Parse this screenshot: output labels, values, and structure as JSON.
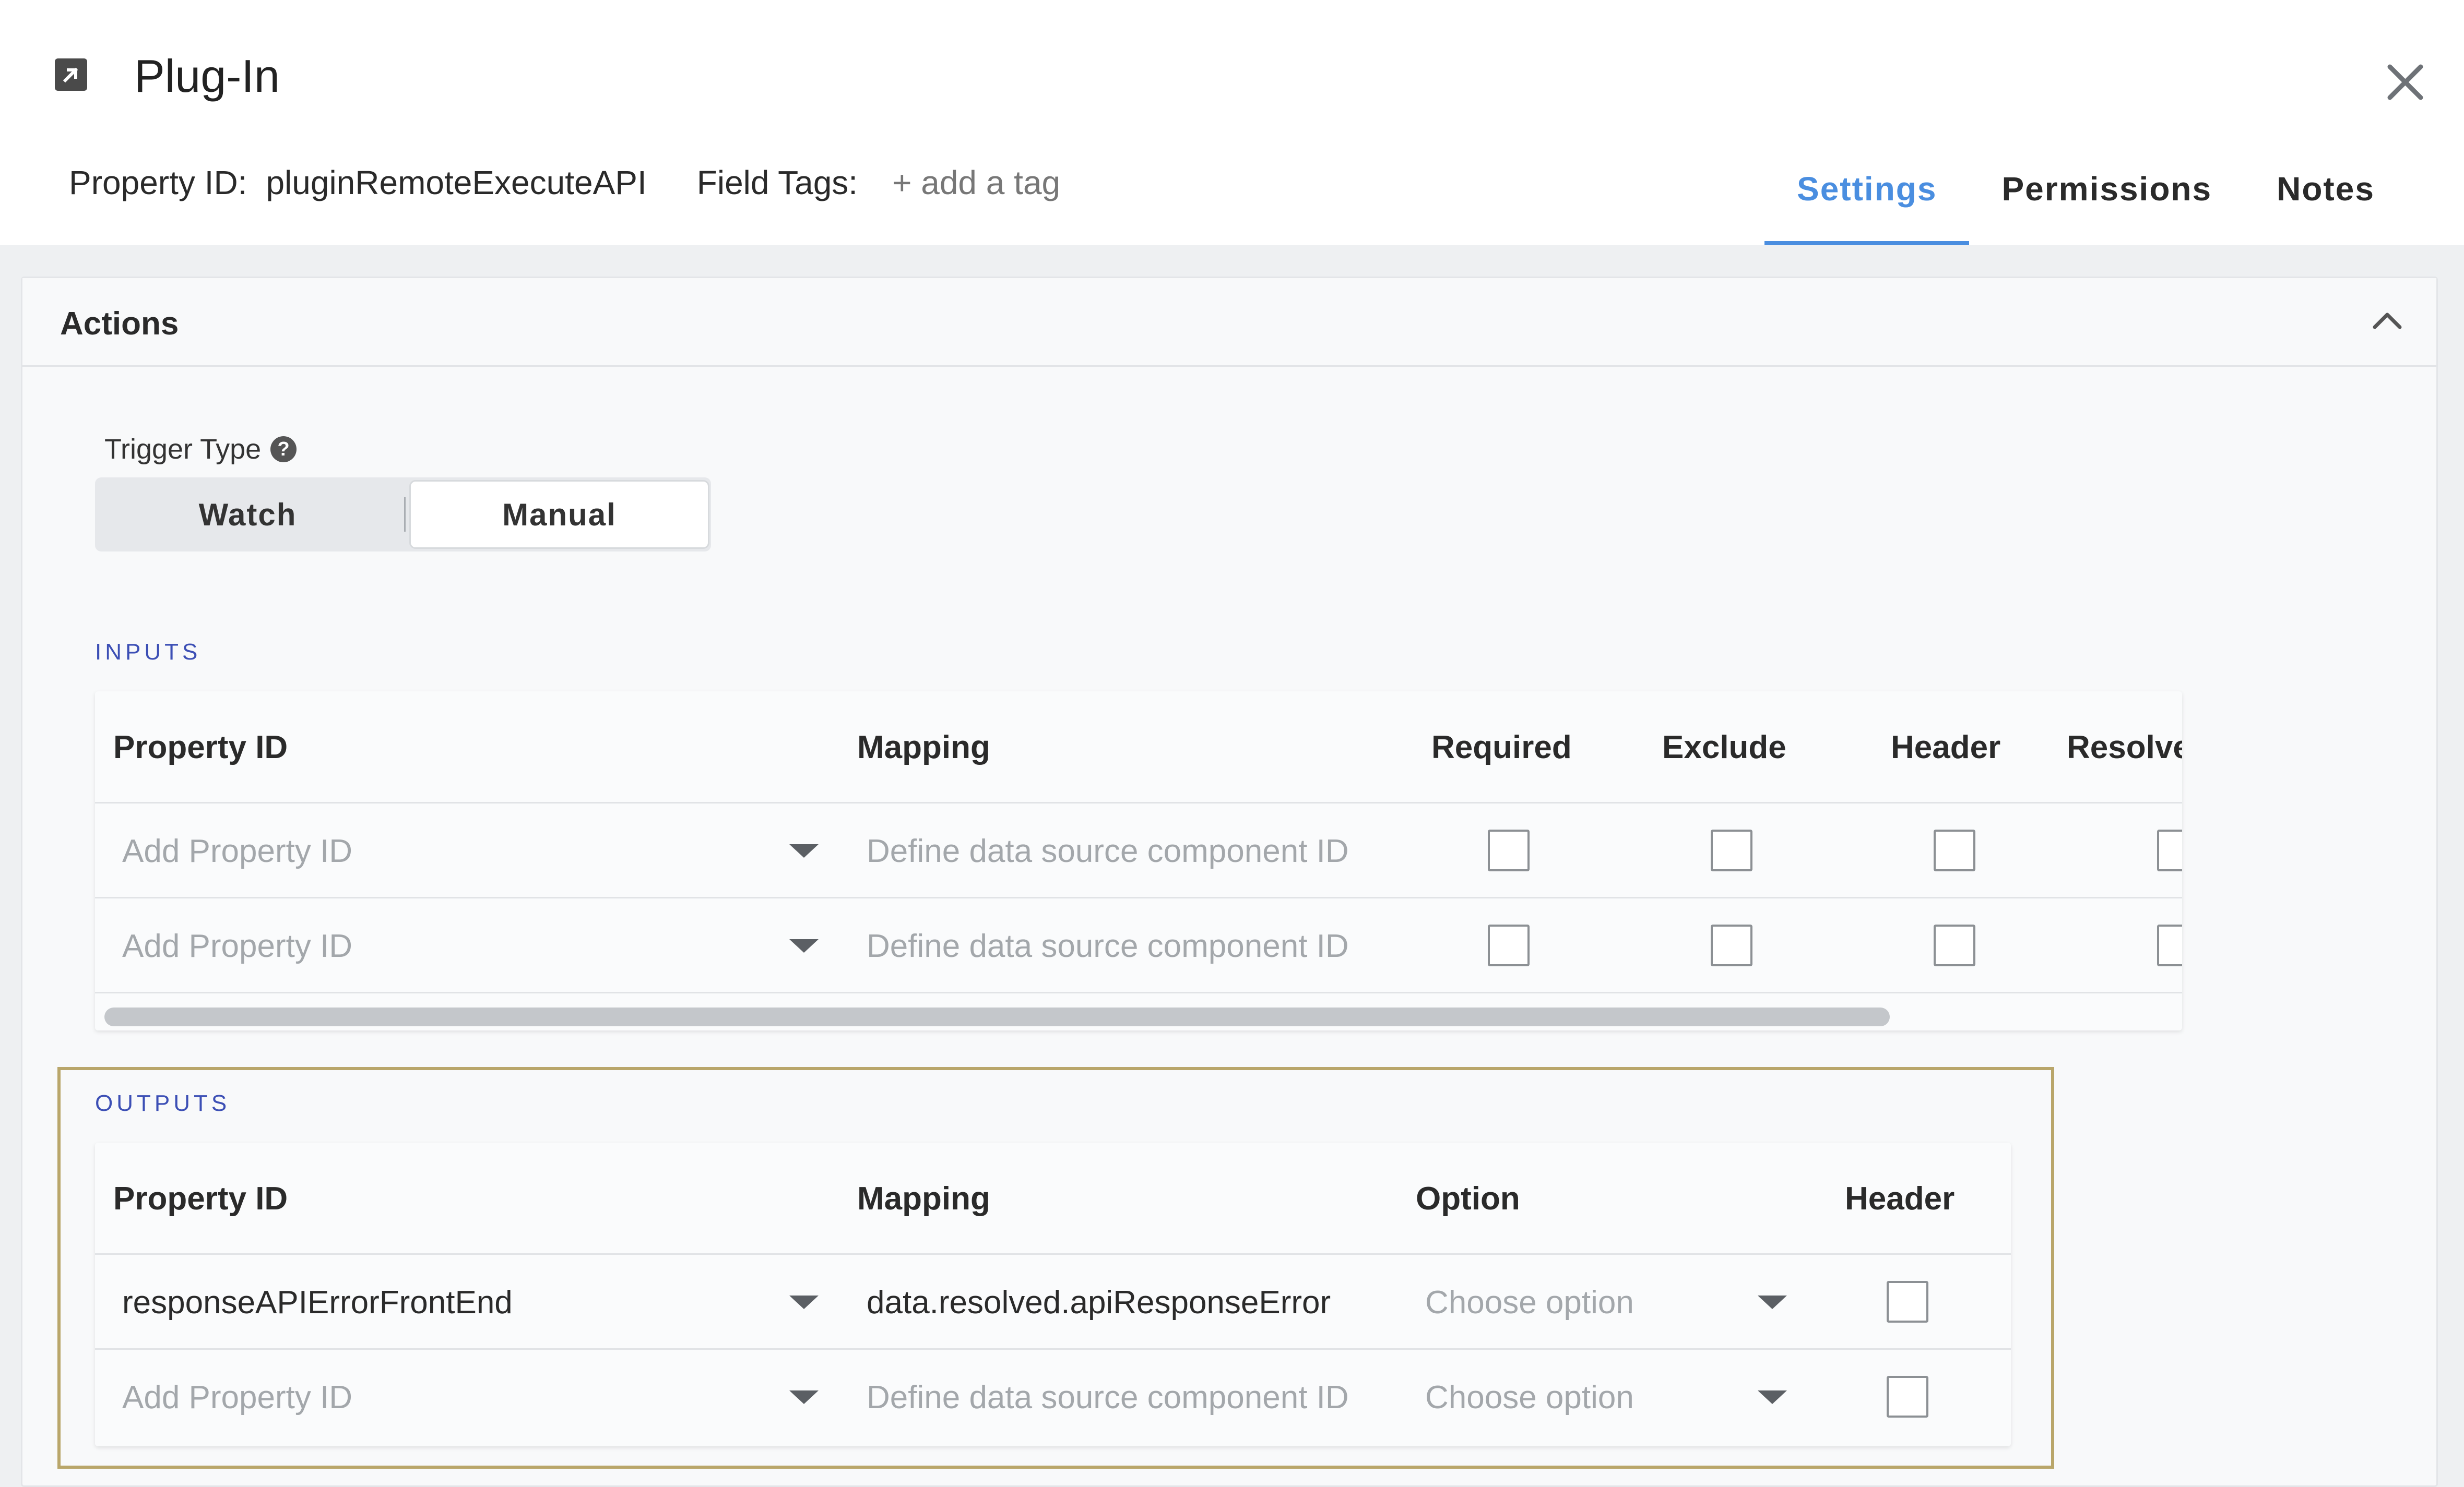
{
  "header": {
    "title": "Plug-In",
    "property_id_label": "Property ID:",
    "property_id_value": "pluginRemoteExecuteAPI",
    "field_tags_label": "Field Tags:",
    "add_tag_label": "+ add a tag",
    "tabs": [
      {
        "label": "Settings",
        "active": true
      },
      {
        "label": "Permissions",
        "active": false
      },
      {
        "label": "Notes",
        "active": false
      }
    ]
  },
  "actions": {
    "title": "Actions",
    "trigger_type_label": "Trigger Type",
    "trigger_options": [
      "Watch",
      "Manual"
    ],
    "selected_trigger": "Manual"
  },
  "inputs": {
    "section_label": "INPUTS",
    "columns": [
      "Property ID",
      "Mapping",
      "Required",
      "Exclude",
      "Header",
      "Resolve"
    ],
    "rows": [
      {
        "property_id_placeholder": "Add Property ID",
        "mapping_placeholder": "Define data source component ID",
        "required": false,
        "exclude": false,
        "header": false,
        "resolve": false
      },
      {
        "property_id_placeholder": "Add Property ID",
        "mapping_placeholder": "Define data source component ID",
        "required": false,
        "exclude": false,
        "header": false,
        "resolve": false
      }
    ]
  },
  "outputs": {
    "section_label": "OUTPUTS",
    "columns": [
      "Property ID",
      "Mapping",
      "Option",
      "Header"
    ],
    "rows": [
      {
        "property_id": "responseAPIErrorFrontEnd",
        "mapping": "data.resolved.apiResponseError",
        "option_placeholder": "Choose option",
        "header": false
      },
      {
        "property_id_placeholder": "Add Property ID",
        "mapping_placeholder": "Define data source component ID",
        "option_placeholder": "Choose option",
        "header": false
      }
    ]
  },
  "colors": {
    "accent": "#4a8ee0",
    "section_label": "#3c4fb5",
    "highlight_frame": "#b9a66a"
  }
}
